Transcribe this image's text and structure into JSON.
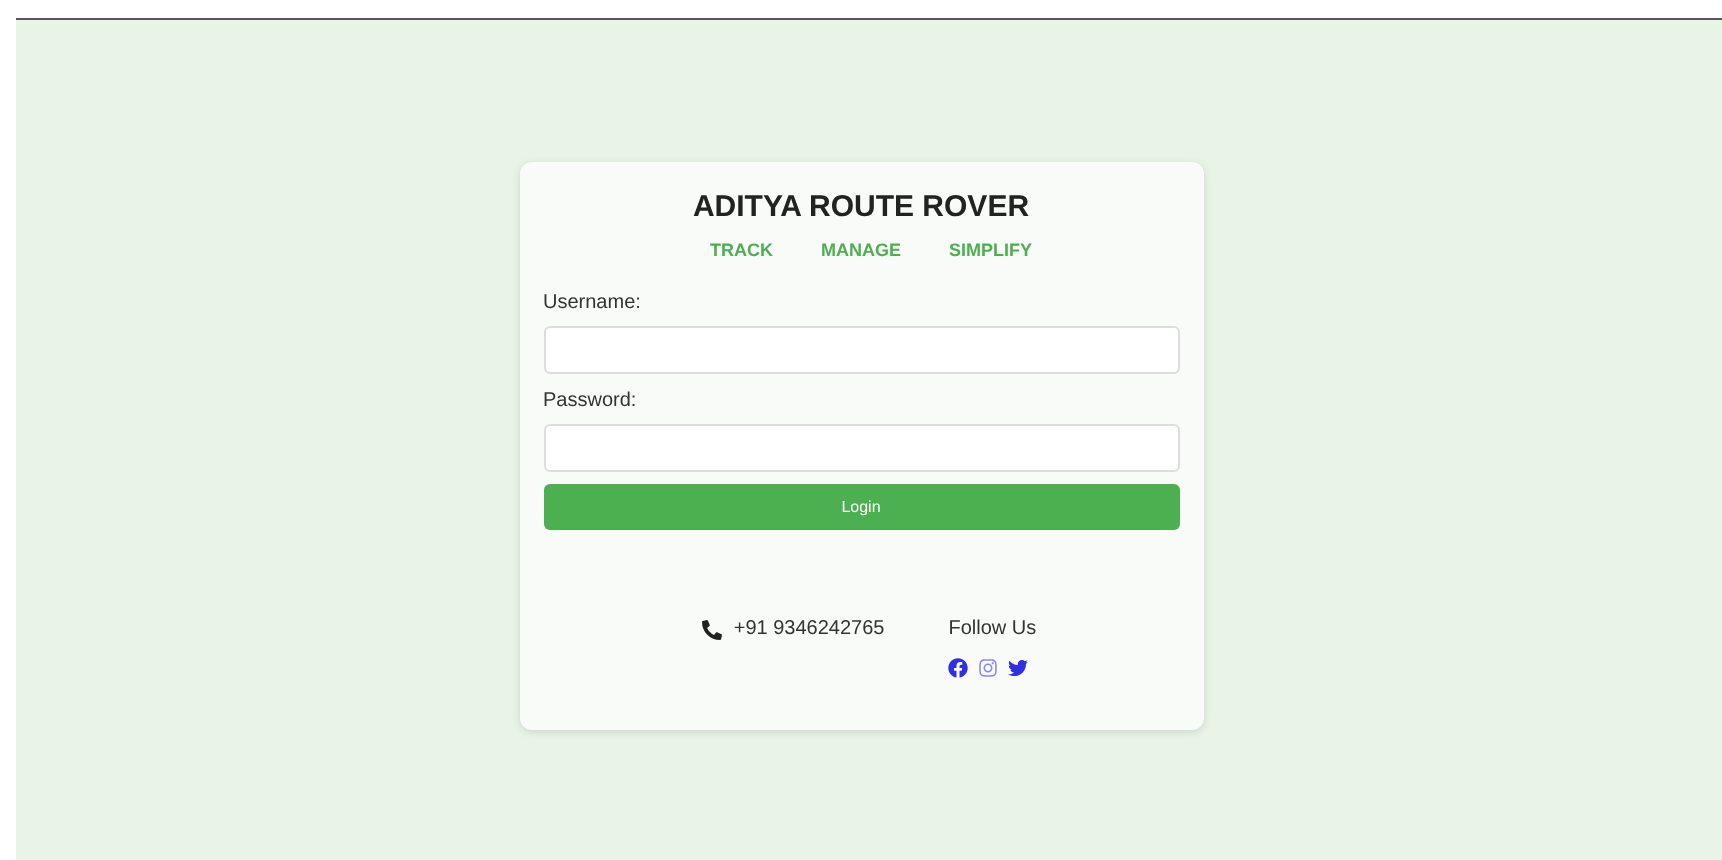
{
  "brand": {
    "title": "ADITYA ROUTE ROVER",
    "taglines": [
      "TRACK",
      "MANAGE",
      "SIMPLIFY"
    ]
  },
  "form": {
    "fields": [
      {
        "label": "Username:"
      },
      {
        "label": "Password:"
      }
    ],
    "submit": "Login"
  },
  "footer": {
    "phone": "+91 9346242765",
    "social_heading": "Follow Us"
  }
}
